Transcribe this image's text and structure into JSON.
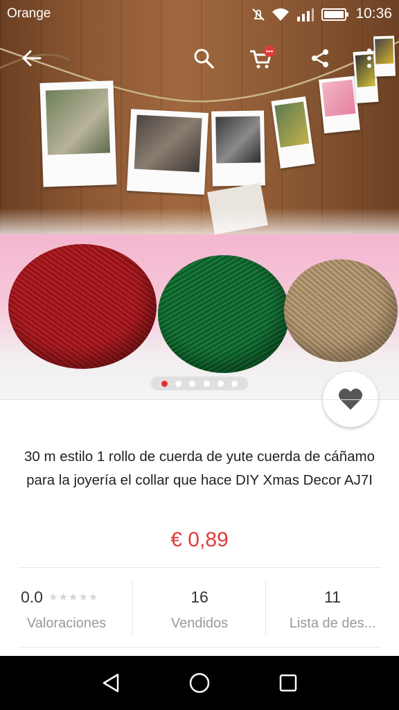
{
  "status_bar": {
    "carrier": "Orange",
    "time": "10:36",
    "icons": [
      "mute-icon",
      "wifi-icon",
      "signal-icon",
      "battery-icon"
    ]
  },
  "top_nav": {
    "icons": [
      "back-arrow-icon",
      "search-icon",
      "cart-icon",
      "share-icon",
      "more-icon"
    ],
    "cart_badge": "•••"
  },
  "gallery": {
    "image_count": 6,
    "active_index": 0
  },
  "product": {
    "title": "30 m estilo 1 rollo de cuerda de yute cuerda de cáñamo para la joyería el collar que hace DIY Xmas Decor AJ7I",
    "price": "€ 0,89",
    "price_color": "#e23a3a"
  },
  "stats": {
    "rating": {
      "value": "0.0",
      "label": "Valoraciones",
      "stars": "★★★★★"
    },
    "sold": {
      "value": "16",
      "label": "Vendidos"
    },
    "wishlist": {
      "value": "11",
      "label": "Lista de des..."
    }
  },
  "android_nav": {
    "icons": [
      "back-triangle-icon",
      "home-circle-icon",
      "recents-square-icon"
    ]
  },
  "colors": {
    "accent": "#e62e2e",
    "text": "#222222",
    "muted": "#999999"
  }
}
